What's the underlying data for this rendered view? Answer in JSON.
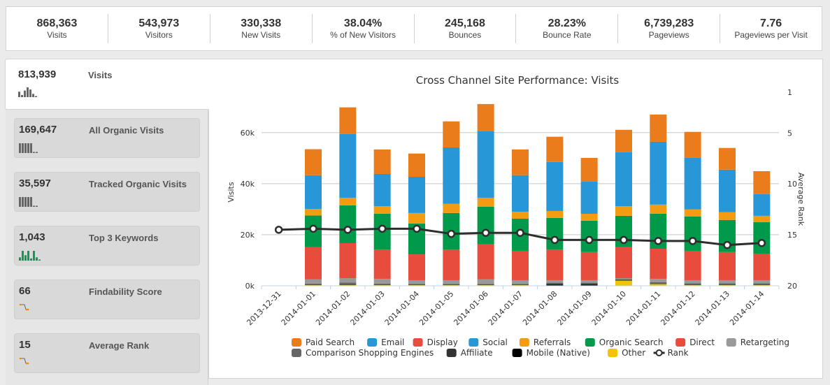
{
  "kpis": [
    {
      "value": "868,363",
      "label": "Visits"
    },
    {
      "value": "543,973",
      "label": "Visitors"
    },
    {
      "value": "330,338",
      "label": "New Visits"
    },
    {
      "value": "38.04%",
      "label": "% of New Visitors"
    },
    {
      "value": "245,168",
      "label": "Bounces"
    },
    {
      "value": "28.23%",
      "label": "Bounce Rate"
    },
    {
      "value": "6,739,283",
      "label": "Pageviews"
    },
    {
      "value": "7.76",
      "label": "Pageviews per Visit"
    }
  ],
  "metrics": [
    {
      "value": "813,939",
      "label": "Visits",
      "spark": "bars",
      "spark_color": "#666666",
      "spark_values": [
        5,
        2,
        6,
        9,
        7,
        3,
        1
      ],
      "active": true
    },
    {
      "value": "169,647",
      "label": "All Organic Visits",
      "spark": "bars",
      "spark_color": "#666666",
      "spark_values": [
        9,
        9,
        9,
        9,
        9,
        1,
        1
      ]
    },
    {
      "value": "35,597",
      "label": "Tracked Organic Visits",
      "spark": "bars",
      "spark_color": "#666666",
      "spark_values": [
        9,
        9,
        9,
        9,
        9,
        1,
        1
      ]
    },
    {
      "value": "1,043",
      "label": "Top 3 Keywords",
      "spark": "bars",
      "spark_color": "#0e9a52",
      "spark_values": [
        3,
        9,
        5,
        9,
        2,
        9,
        3,
        1
      ]
    },
    {
      "value": "66",
      "label": "Findability Score",
      "spark": "step",
      "spark_color": "#f08a00"
    },
    {
      "value": "15",
      "label": "Average Rank",
      "spark": "step",
      "spark_color": "#f08a00"
    }
  ],
  "chart_data": {
    "type": "bar",
    "stacked": true,
    "title": "Cross Channel Site Performance: Visits",
    "xlabel": "",
    "ylabel": "Visits",
    "y2label": "Average Rank",
    "ylim": [
      0,
      70000
    ],
    "y_ticks": [
      "0k",
      "20k",
      "40k",
      "60k"
    ],
    "y2lim": [
      1,
      20
    ],
    "y2_ticks": [
      "1",
      "5",
      "10",
      "15",
      "20"
    ],
    "y2_reversed": true,
    "grid": true,
    "legend": "bottom",
    "categories": [
      "2013-12-31",
      "2014-01-01",
      "2014-01-02",
      "2014-01-03",
      "2014-01-04",
      "2014-01-05",
      "2014-01-06",
      "2014-01-07",
      "2014-01-08",
      "2014-01-09",
      "2014-01-10",
      "2014-01-11",
      "2014-01-12",
      "2014-01-13",
      "2014-01-14"
    ],
    "series": [
      {
        "name": "Other",
        "color": "#f2c500",
        "values": [
          0,
          300,
          300,
          300,
          300,
          300,
          300,
          300,
          100,
          100,
          2000,
          700,
          300,
          300,
          300
        ]
      },
      {
        "name": "Mobile (Native)",
        "color": "#000000",
        "values": [
          0,
          0,
          0,
          0,
          0,
          0,
          0,
          0,
          400,
          400,
          0,
          0,
          0,
          0,
          0
        ]
      },
      {
        "name": "Affiliate",
        "color": "#333333",
        "values": [
          0,
          100,
          100,
          100,
          100,
          100,
          100,
          100,
          300,
          300,
          200,
          100,
          100,
          100,
          100
        ]
      },
      {
        "name": "Comparison Shopping Engines",
        "color": "#666666",
        "values": [
          0,
          400,
          900,
          400,
          300,
          300,
          300,
          300,
          400,
          400,
          500,
          600,
          600,
          600,
          600
        ]
      },
      {
        "name": "Retargeting",
        "color": "#999999",
        "values": [
          0,
          1700,
          1700,
          1900,
          1500,
          1500,
          1800,
          1500,
          1000,
          1000,
          300,
          1300,
          1200,
          1200,
          1200
        ]
      },
      {
        "name": "Direct",
        "color": "#e84c3d",
        "values": [
          0,
          12700,
          13700,
          11500,
          10100,
          12000,
          13700,
          11500,
          12000,
          11000,
          12100,
          11800,
          11500,
          11000,
          10400
        ]
      },
      {
        "name": "Organic Search",
        "color": "#019a4a",
        "values": [
          0,
          12300,
          14800,
          14000,
          12100,
          14300,
          14800,
          12600,
          12400,
          12300,
          12300,
          13700,
          13400,
          12600,
          12300
        ]
      },
      {
        "name": "Referrals",
        "color": "#f39c12",
        "values": [
          0,
          2600,
          3000,
          3000,
          4100,
          3600,
          3500,
          2700,
          2700,
          2700,
          3800,
          3600,
          2800,
          3000,
          2500
        ]
      },
      {
        "name": "Social",
        "color": "#2897d8",
        "values": [
          0,
          13200,
          25000,
          12600,
          14200,
          22100,
          26000,
          14300,
          19200,
          12600,
          21100,
          24600,
          20200,
          16700,
          8500
        ]
      },
      {
        "name": "Display",
        "color": "#e84c3d",
        "values": [
          0,
          0,
          0,
          0,
          0,
          0,
          0,
          0,
          0,
          0,
          0,
          0,
          0,
          0,
          0
        ]
      },
      {
        "name": "Email",
        "color": "#2897d8",
        "values": [
          0,
          0,
          0,
          0,
          0,
          0,
          0,
          0,
          0,
          0,
          0,
          0,
          0,
          0,
          0
        ]
      },
      {
        "name": "Paid Search",
        "color": "#eb7c1c",
        "values": [
          0,
          10200,
          10400,
          9600,
          9100,
          10200,
          10700,
          10100,
          9900,
          9300,
          8800,
          10700,
          10200,
          8500,
          9000
        ]
      }
    ],
    "line_series": {
      "name": "Rank",
      "axis": "right",
      "color": "#2e2e2e",
      "values": [
        14.5,
        14.4,
        14.5,
        14.4,
        14.4,
        14.9,
        14.8,
        14.8,
        15.5,
        15.5,
        15.5,
        15.6,
        15.6,
        16.0,
        15.8
      ]
    },
    "legend_items": [
      {
        "name": "Paid Search",
        "color": "#eb7c1c"
      },
      {
        "name": "Email",
        "color": "#2897d8"
      },
      {
        "name": "Display",
        "color": "#e84c3d"
      },
      {
        "name": "Social",
        "color": "#2897d8"
      },
      {
        "name": "Referrals",
        "color": "#f39c12"
      },
      {
        "name": "Organic Search",
        "color": "#019a4a"
      },
      {
        "name": "Direct",
        "color": "#e84c3d"
      },
      {
        "name": "Retargeting",
        "color": "#999999"
      },
      {
        "name": "Comparison Shopping Engines",
        "color": "#666666"
      },
      {
        "name": "Affiliate",
        "color": "#333333"
      },
      {
        "name": "Mobile (Native)",
        "color": "#000000"
      },
      {
        "name": "Other",
        "color": "#f2c500"
      },
      {
        "name": "Rank",
        "color": "#2e2e2e",
        "marker": "line-circle"
      }
    ]
  }
}
